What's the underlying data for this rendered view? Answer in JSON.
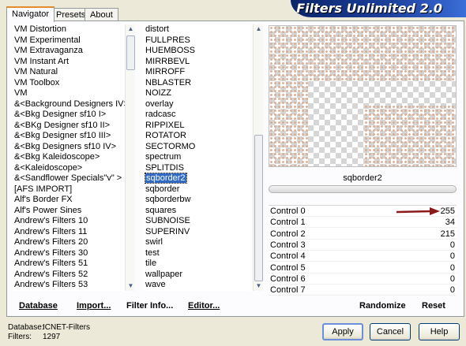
{
  "tabs": [
    "Navigator",
    "Presets",
    "About"
  ],
  "banner_title": "Filters Unlimited 2.0",
  "categories": [
    "VM Distortion",
    "VM Experimental",
    "VM Extravaganza",
    "VM Instant Art",
    "VM Natural",
    "VM Toolbox",
    "VM",
    "&<Background Designers IV>",
    "&<Bkg Designer sf10 I>",
    "&<BKg Designer sf10 II>",
    "&<Bkg Designer sf10 III>",
    "&<Bkg Designers sf10 IV>",
    "&<Bkg Kaleidoscope>",
    "&<Kaleidoscope>",
    "&<Sandflower Specials\"v\" >",
    "[AFS IMPORT]",
    "Alf's Border FX",
    "Alf's Power Sines",
    "Andrew's Filters 10",
    "Andrew's Filters 11",
    "Andrew's Filters 20",
    "Andrew's Filters 30",
    "Andrew's Filters 51",
    "Andrew's Filters 52",
    "Andrew's Filters 53"
  ],
  "filters": [
    "distort",
    "FULLPRES",
    "HUEMBOSS",
    "MIRRBEVL",
    "MIRROFF",
    "NBLASTER",
    "NOIZZ",
    "overlay",
    "radcasc",
    "RIPPIXEL",
    "ROTATOR",
    "SECTORMO",
    "spectrum",
    "SPLITDIS",
    "sqborder2",
    "sqborder",
    "sqborderbw",
    "squares",
    "SUBNOISE",
    "SUPERINV",
    "swirl",
    "test",
    "tile",
    "wallpaper",
    "wave"
  ],
  "selected_filter_index": 14,
  "filter_name": "sqborder2",
  "controls": [
    {
      "label": "Control 0",
      "value": "255"
    },
    {
      "label": "Control 1",
      "value": "34"
    },
    {
      "label": "Control 2",
      "value": "215"
    },
    {
      "label": "Control 3",
      "value": "0"
    },
    {
      "label": "Control 4",
      "value": "0"
    },
    {
      "label": "Control 5",
      "value": "0"
    },
    {
      "label": "Control 6",
      "value": "0"
    },
    {
      "label": "Control 7",
      "value": "0"
    }
  ],
  "buttons": {
    "database": "Database",
    "import": "Import...",
    "filter_info": "Filter Info...",
    "editor": "Editor...",
    "randomize": "Randomize",
    "reset": "Reset",
    "apply": "Apply",
    "cancel": "Cancel",
    "help": "Help"
  },
  "status": {
    "database_label": "Database:",
    "database_value": "ICNET-Filters",
    "filters_label": "Filters:",
    "filters_value": "1297"
  },
  "colors": {
    "accent_arrow": "#8b1a1a",
    "selection": "#316ac5",
    "banner": "#0a246a"
  }
}
